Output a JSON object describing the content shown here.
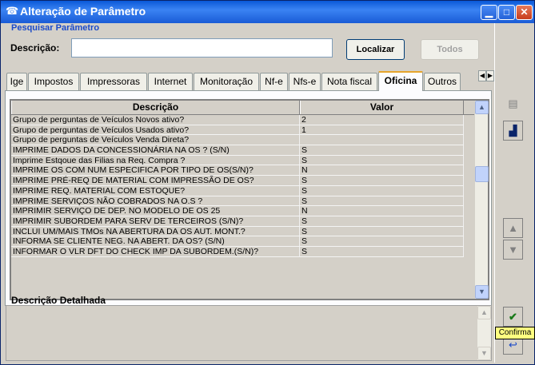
{
  "window": {
    "title": "Alteração de Parâmetro"
  },
  "search": {
    "section_label": "Pesquisar Parâmetro",
    "field_label": "Descrição:",
    "value": "",
    "find_button": "Localizar",
    "all_button": "Todos"
  },
  "tabs": [
    {
      "label": "Ige"
    },
    {
      "label": "Impostos"
    },
    {
      "label": "Impressoras"
    },
    {
      "label": "Internet"
    },
    {
      "label": "Monitoração"
    },
    {
      "label": "Nf-e"
    },
    {
      "label": "Nfs-e"
    },
    {
      "label": "Nota fiscal"
    },
    {
      "label": "Oficina",
      "active": true
    },
    {
      "label": "Outros"
    }
  ],
  "grid": {
    "columns": [
      "Descrição",
      "Valor"
    ],
    "rows": [
      [
        "Grupo de perguntas de Veículos Novos ativo?",
        "2"
      ],
      [
        "Grupo de perguntas de Veículos Usados ativo?",
        "1"
      ],
      [
        "Grupo de perguntas de Veículos Venda Direta?",
        ""
      ],
      [
        "IMPRIME DADOS DA CONCESSIONÁRIA NA OS ? (S/N)",
        "S"
      ],
      [
        "Imprime Estqoue das Filias na Req. Compra ?",
        "S"
      ],
      [
        "IMPRIME OS COM NUM ESPECIFICA POR TIPO DE OS(S/N)?",
        "N"
      ],
      [
        "IMPRIME PRÉ-REQ DE MATERIAL COM IMPRESSÃO DE OS?",
        "S"
      ],
      [
        "IMPRIME REQ. MATERIAL COM ESTOQUE?",
        "S"
      ],
      [
        "IMPRIME SERVIÇOS NÃO COBRADOS NA O.S ?",
        "S"
      ],
      [
        "IMPRIMIR SERVIÇO DE DEP. NO MODELO DE OS 25",
        "N"
      ],
      [
        "IMPRIMIR SUBORDEM PARA SERV DE TERCEIROS (S/N)?",
        "S"
      ],
      [
        "INCLUI UM/MAIS TMOs NA ABERTURA DA OS AUT. MONT.?",
        "S"
      ],
      [
        "INFORMA SE CLIENTE NEG. NA ABERT. DA OS? (S/N)",
        "S"
      ],
      [
        "INFORMAR O VLR DFT DO CHECK IMP DA SUBORDEM.(S/N)?",
        "S"
      ]
    ]
  },
  "detail": {
    "label": "Descrição Detalhada",
    "value": ""
  },
  "tooltip": {
    "text": "Confirma"
  }
}
